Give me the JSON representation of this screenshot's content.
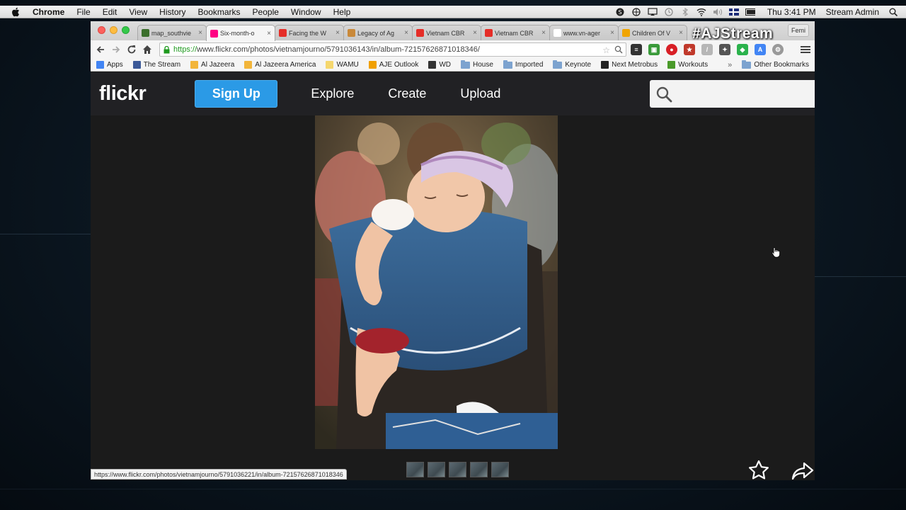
{
  "menubar": {
    "app_name": "Chrome",
    "menus": [
      "File",
      "Edit",
      "View",
      "History",
      "Bookmarks",
      "People",
      "Window",
      "Help"
    ],
    "clock": "Thu 3:41 PM",
    "user": "Stream Admin"
  },
  "browser": {
    "tabs": [
      {
        "title": "map_southvie",
        "favicon_color": "#3b6f2c"
      },
      {
        "title": "Six-month-o",
        "favicon_color": "#ff0084",
        "active": true
      },
      {
        "title": "Facing the W",
        "favicon_color": "#e52d27"
      },
      {
        "title": "Legacy of Ag",
        "favicon_color": "#c9893a"
      },
      {
        "title": "Vietnam CBR",
        "favicon_color": "#e52d27"
      },
      {
        "title": "Vietnam CBR",
        "favicon_color": "#e52d27"
      },
      {
        "title": "www.vn-ager",
        "favicon_color": "#ffffff"
      },
      {
        "title": "Children Of V",
        "favicon_color": "#f0a500"
      }
    ],
    "profile_label": "Femi",
    "overlay_hashtag": "#AJStream",
    "url_scheme": "https://",
    "url_rest": "www.flickr.com/photos/vietnamjourno/5791036143/in/album-72157626871018346/",
    "bookmarks": [
      {
        "label": "Apps",
        "icon": "apps-grid-icon",
        "color": "#4285f4"
      },
      {
        "label": "The Stream",
        "icon": "facebook-icon",
        "color": "#3b5998"
      },
      {
        "label": "Al Jazeera",
        "icon": "aljazeera-icon",
        "color": "#f2b53a"
      },
      {
        "label": "Al Jazeera America",
        "icon": "aljazeera-icon",
        "color": "#f2b53a"
      },
      {
        "label": "WAMU",
        "icon": "wamu-icon",
        "color": "#f5d76e"
      },
      {
        "label": "AJE Outlook",
        "icon": "outlook-icon",
        "color": "#f0a000"
      },
      {
        "label": "WD",
        "icon": "wd-icon",
        "color": "#333333"
      },
      {
        "label": "House",
        "icon": "folder-icon"
      },
      {
        "label": "Imported",
        "icon": "folder-icon"
      },
      {
        "label": "Keynote",
        "icon": "folder-icon"
      },
      {
        "label": "Next Metrobus",
        "icon": "metro-icon",
        "color": "#222222"
      },
      {
        "label": "Workouts",
        "icon": "workouts-icon",
        "color": "#4a9a2a"
      }
    ],
    "bookmarks_overflow": "»",
    "other_bookmarks": "Other Bookmarks",
    "status_url": "https://www.flickr.com/photos/vietnamjourno/5791036221/in/album-72157626871018346"
  },
  "flickr": {
    "logo": "flickr",
    "signup_label": "Sign Up",
    "nav": [
      "Explore",
      "Create",
      "Upload"
    ],
    "search_placeholder": "",
    "thumbnail_count": 5
  },
  "colors": {
    "flickr_blue": "#2b9ae6",
    "header_bg": "#212124",
    "page_bg": "#1b1b1b"
  }
}
